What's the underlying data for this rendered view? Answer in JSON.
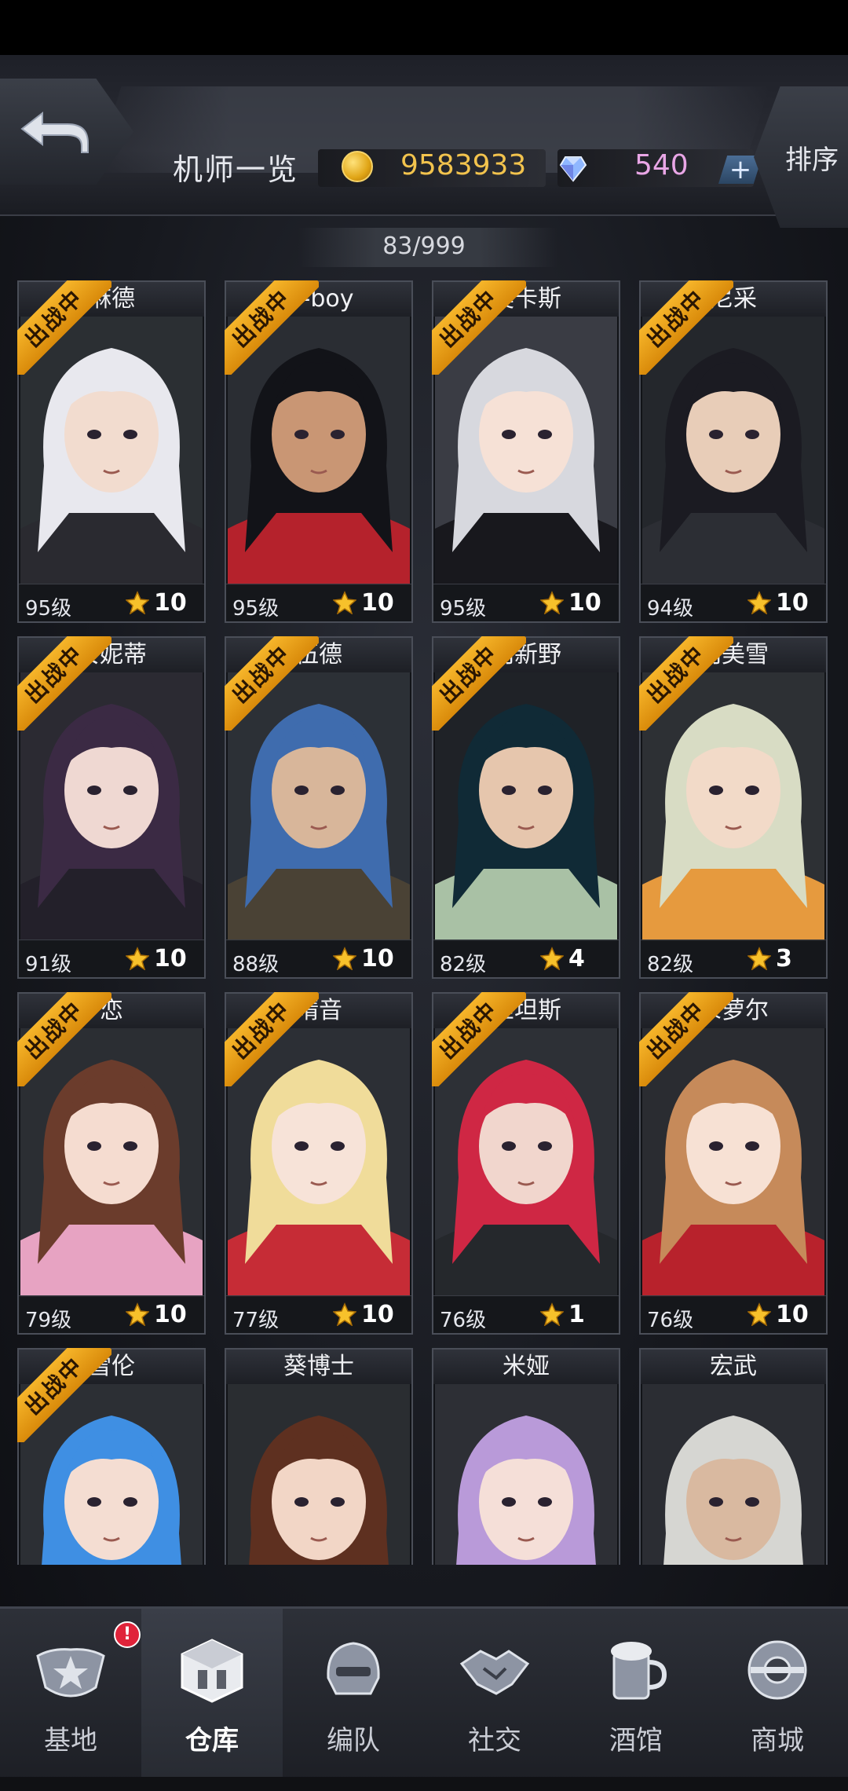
{
  "header": {
    "title": "机师一览",
    "coins": "9583933",
    "gems": "540",
    "plus_label": "+",
    "sort_label": "排序"
  },
  "roster_count": "83/999",
  "deploy_label": "出战中",
  "pilots": [
    {
      "name": "麻德",
      "level": "95级",
      "stars": "10",
      "deployed": true,
      "hair": "#e8e8ee",
      "skin": "#f2dccf",
      "cloth": "#2a2a30",
      "bg": "#2b2f33"
    },
    {
      "name": "D-boy",
      "level": "95级",
      "stars": "10",
      "deployed": true,
      "hair": "#121318",
      "skin": "#c99674",
      "cloth": "#b5222c",
      "bg": "#2a2d33"
    },
    {
      "name": "奥卡斯",
      "level": "95级",
      "stars": "10",
      "deployed": true,
      "hair": "#d7d8de",
      "skin": "#f6e1d6",
      "cloth": "#18181d",
      "bg": "#3a3c44"
    },
    {
      "name": "尼采",
      "level": "94级",
      "stars": "10",
      "deployed": true,
      "hair": "#1b1b22",
      "skin": "#e8cdb8",
      "cloth": "#2c2e34",
      "bg": "#24272c"
    },
    {
      "name": "安妮蒂",
      "level": "91级",
      "stars": "10",
      "deployed": true,
      "hair": "#3b2a44",
      "skin": "#efd8d2",
      "cloth": "#23202a",
      "bg": "#2b2a32"
    },
    {
      "name": "伍德",
      "level": "88级",
      "stars": "10",
      "deployed": true,
      "hair": "#3f6cae",
      "skin": "#d8b69a",
      "cloth": "#4a4235",
      "bg": "#2c3036"
    },
    {
      "name": "羽新野",
      "level": "82级",
      "stars": "4",
      "deployed": true,
      "hair": "#102a36",
      "skin": "#e6c6ad",
      "cloth": "#a9c1a5",
      "bg": "#1f2227"
    },
    {
      "name": "羽美雪",
      "level": "82级",
      "stars": "3",
      "deployed": true,
      "hair": "#d8dcc4",
      "skin": "#f2dac8",
      "cloth": "#e69a3e",
      "bg": "#2d3034"
    },
    {
      "name": "恋",
      "level": "79级",
      "stars": "10",
      "deployed": true,
      "hair": "#6b3c2c",
      "skin": "#f5dcd0",
      "cloth": "#e7a3c2",
      "bg": "#2b2e33"
    },
    {
      "name": "晴音",
      "level": "77级",
      "stars": "10",
      "deployed": true,
      "hair": "#f0dc9a",
      "skin": "#f7e3d8",
      "cloth": "#c62c36",
      "bg": "#2c2f35"
    },
    {
      "name": "丝坦斯",
      "level": "76级",
      "stars": "1",
      "deployed": true,
      "hair": "#cf2744",
      "skin": "#f1d6cd",
      "cloth": "#25282c",
      "bg": "#2d3036"
    },
    {
      "name": "朵萝尔",
      "level": "76级",
      "stars": "10",
      "deployed": true,
      "hair": "#c68a5a",
      "skin": "#f7e1d4",
      "cloth": "#b8222c",
      "bg": "#2a2c31"
    },
    {
      "name": "雪伦",
      "level": "",
      "stars": "",
      "deployed": true,
      "hair": "#3f8fe3",
      "skin": "#f4ddd2",
      "cloth": "#cf8fb8",
      "bg": "#2c2f34"
    },
    {
      "name": "葵博士",
      "level": "",
      "stars": "",
      "deployed": false,
      "hair": "#5e3020",
      "skin": "#f2d6c6",
      "cloth": "#d9c3b4",
      "bg": "#2a2d31"
    },
    {
      "name": "米娅",
      "level": "",
      "stars": "",
      "deployed": false,
      "hair": "#b99ad9",
      "skin": "#f5dfd8",
      "cloth": "#2a2a30",
      "bg": "#2d2f35"
    },
    {
      "name": "宏武",
      "level": "",
      "stars": "",
      "deployed": false,
      "hair": "#d6d6d2",
      "skin": "#d9b9a0",
      "cloth": "#2f3c55",
      "bg": "#2b2d33"
    }
  ],
  "nav": {
    "items": [
      {
        "label": "基地",
        "icon": "base-emblem-icon",
        "badge": "!"
      },
      {
        "label": "仓库",
        "icon": "warehouse-icon",
        "active": true
      },
      {
        "label": "编队",
        "icon": "helmet-icon"
      },
      {
        "label": "社交",
        "icon": "handshake-icon"
      },
      {
        "label": "酒馆",
        "icon": "beer-mug-icon"
      },
      {
        "label": "商城",
        "icon": "shop-orb-icon"
      }
    ]
  }
}
